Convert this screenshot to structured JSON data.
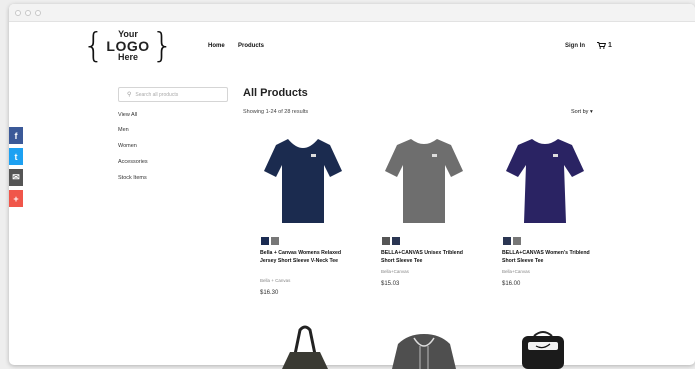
{
  "logo": {
    "line1": "Your",
    "line2": "LOGO",
    "line3": "Here"
  },
  "nav": {
    "home": "Home",
    "products": "Products",
    "signin": "Sign In",
    "cart_count": "1"
  },
  "search": {
    "placeholder": "Search all products"
  },
  "sidebar": {
    "items": [
      "View All",
      "Men",
      "Women",
      "Accessories",
      "Stock Items"
    ]
  },
  "main": {
    "title": "All Products",
    "results": "Showing 1-24 of 28 results",
    "sort_label": "Sort by"
  },
  "social": [
    {
      "icon": "facebook-icon",
      "glyph": "f",
      "color": "#3b5998"
    },
    {
      "icon": "twitter-icon",
      "glyph": "t",
      "color": "#1da1f2"
    },
    {
      "icon": "email-icon",
      "glyph": "✉",
      "color": "#555555"
    },
    {
      "icon": "plus-icon",
      "glyph": "+",
      "color": "#f0564a"
    }
  ],
  "products": [
    {
      "name": "Bella + Canvas Womens Relaxed Jersey Short Sleeve V-Neck Tee",
      "brand": "Bella + Canvas",
      "price": "$16.30",
      "color": "#1b2b4f",
      "swatches": [
        "#1b2b52",
        "#777777"
      ]
    },
    {
      "name": "BELLA+CANVAS Unisex Triblend Short Sleeve Tee",
      "brand": "Bella+Canvas",
      "price": "$15.03",
      "color": "#6e6e6e",
      "swatches": [
        "#555555",
        "#2a3552"
      ]
    },
    {
      "name": "BELLA+CANVAS Women's Triblend Short Sleeve Tee",
      "brand": "Bella+Canvas",
      "price": "$16.00",
      "color": "#2a2363",
      "swatches": [
        "#2a3552",
        "#777777"
      ]
    }
  ]
}
